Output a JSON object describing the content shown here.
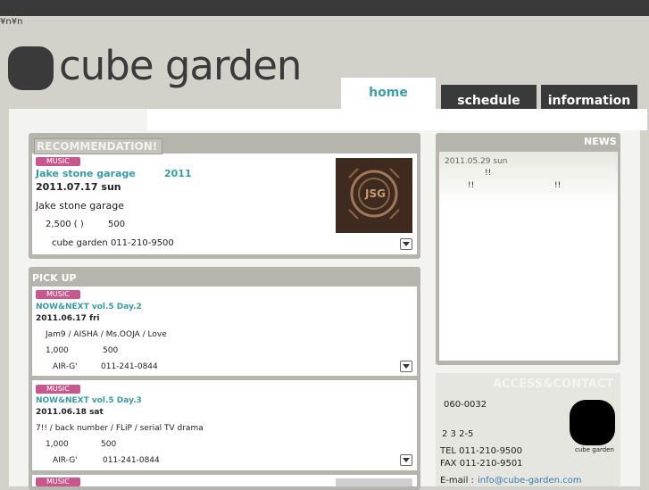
{
  "encoding_text": "¥n¥n",
  "logo": {
    "name": "cube garden",
    "mark_label": "cube garden"
  },
  "nav": {
    "home": "home",
    "schedule": "schedule",
    "information": "information"
  },
  "recommendation": {
    "heading": "RECOMMENDATION!",
    "badge": "MUSIC",
    "title": "Jake stone garage",
    "year": "2011",
    "date": "2011.07.17 sun",
    "artist": "Jake stone garage",
    "price_a": "2,500 ( )",
    "price_b": "500",
    "contact": "cube garden 011-210-9500",
    "album_art_text": "JSG"
  },
  "pickup": {
    "heading": "PICK UP",
    "items": [
      {
        "badge": "MUSIC",
        "title": "NOW&NEXT vol.5 Day.2",
        "date": "2011.06.17 fri",
        "artists": "Jam9 / AISHA / Ms.OOJA / Love",
        "price_a": "1,000",
        "price_b": "500",
        "contact_name": "AIR-G'",
        "contact_tel": "011-241-0844"
      },
      {
        "badge": "MUSIC",
        "title": "NOW&NEXT vol.5 Day.3",
        "date": "2011.06.18 sat",
        "artists": "7!! / back number / FLiP / serial TV drama",
        "price_a": "1,000",
        "price_b": "500",
        "contact_name": "AIR-G'",
        "contact_tel": "011-241-0844"
      },
      {
        "badge": "MUSIC"
      }
    ]
  },
  "news": {
    "heading": "NEWS",
    "date": "2011.05.29 sun",
    "line1": "!!",
    "line2a": "!!",
    "line2b": "!!"
  },
  "access": {
    "heading": "ACCESS&CONTACT",
    "postal": "060-0032",
    "address": "2 3 2-5",
    "tel": "TEL 011-210-9500",
    "fax": "FAX 011-210-9501",
    "email_label": "E-mail :",
    "email": "info@cube-garden.com"
  },
  "colors": {
    "accent_teal": "#3f9ca4",
    "badge_pink": "#c8578d",
    "dark": "#3a3a3a"
  }
}
